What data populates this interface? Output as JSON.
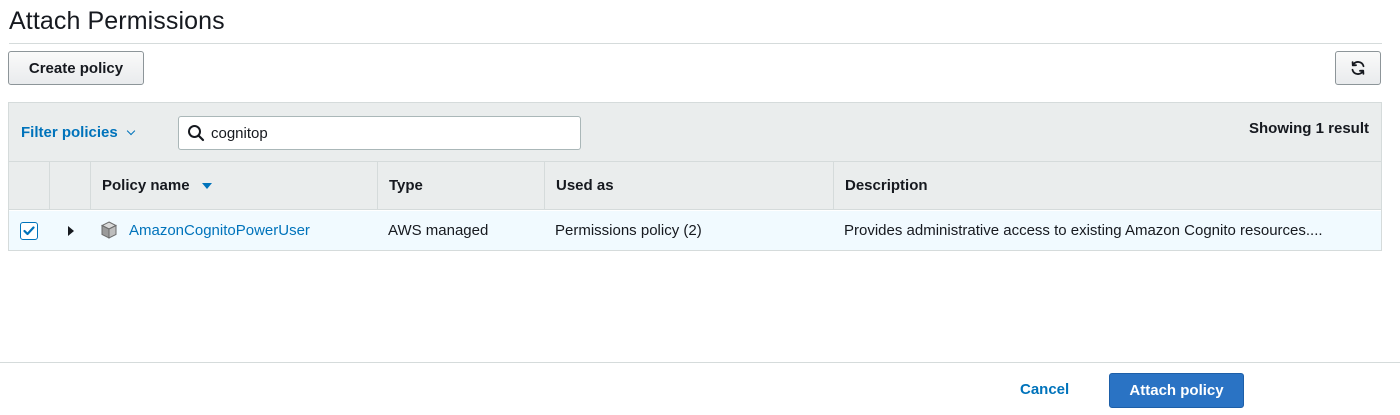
{
  "page": {
    "title": "Attach Permissions"
  },
  "toolbar": {
    "create_label": "Create policy",
    "refresh_icon": "refresh-icon"
  },
  "filter": {
    "dropdown_label": "Filter policies",
    "search_value": "cognitop",
    "result_text": "Showing 1 result"
  },
  "table": {
    "columns": [
      "Policy name",
      "Type",
      "Used as",
      "Description"
    ],
    "sort_column": "Policy name",
    "rows": [
      {
        "selected": true,
        "name": "AmazonCognitoPowerUser",
        "type": "AWS managed",
        "used_as": "Permissions policy (2)",
        "description": "Provides administrative access to existing Amazon Cognito resources...."
      }
    ]
  },
  "footer": {
    "cancel_label": "Cancel",
    "attach_label": "Attach policy"
  },
  "colors": {
    "link": "#0073bb",
    "primary": "#2a73c4",
    "header_bg": "#eaeded",
    "selected_row_bg": "#f1faff"
  }
}
